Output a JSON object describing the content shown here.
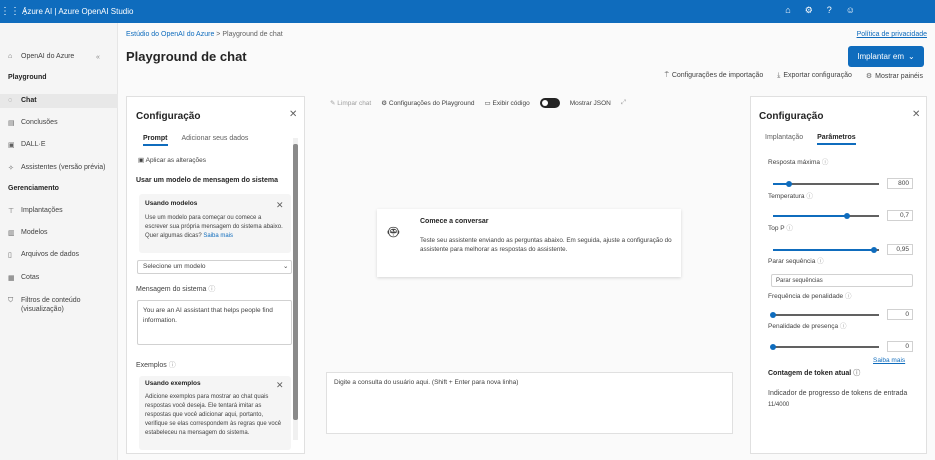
{
  "topbar": {
    "brand": "Azure AI | Azure OpenAI Studio"
  },
  "nav": {
    "openai_link": "OpenAI do Azure",
    "playground_header": "Playground",
    "chat": "Chat",
    "completions": "Conclusões",
    "dalle": "DALL·E",
    "assistants": "Assistentes (versão prévia)",
    "management_header": "Gerenciamento",
    "deployments": "Implantações",
    "models": "Modelos",
    "data_files": "Arquivos de dados",
    "quotas": "Cotas",
    "content_filters": "Filtros de conteúdo (visualização)"
  },
  "header": {
    "breadcrumb_link": "Estúdio do OpenAI do Azure",
    "breadcrumb_sep": ">",
    "breadcrumb_current": "Playground de chat",
    "privacy": "Política de privacidade",
    "title": "Playground de chat",
    "deploy": "Implantar em",
    "import_settings": "Configurações de importação",
    "export_settings": "Exportar configuração",
    "show_panels": "Mostrar painéis"
  },
  "left_panel": {
    "title": "Configuração",
    "tab_prompt": "Prompt",
    "tab_data": "Adicionar seus dados",
    "apply_changes": "Aplicar as alterações",
    "use_template": "Usar um modelo de mensagem do sistema",
    "templates_card_title": "Usando modelos",
    "templates_card_text": "Use um modelo para começar ou comece a escrever sua própria mensagem do sistema abaixo. Quer algumas dicas?",
    "templates_card_link": "Saiba mais",
    "template_select_placeholder": "Selecione um modelo",
    "system_message_label": "Mensagem do sistema",
    "system_message_value": "You are an AI assistant that helps people find information.",
    "examples_label": "Exemplos",
    "examples_card_title": "Usando exemplos",
    "examples_card_text": "Adicione exemplos para mostrar ao chat quais respostas você deseja. Ele tentará imitar as respostas que você adicionar aqui, portanto, verifique se elas correspondem às regras que você estabeleceu na mensagem do sistema."
  },
  "center": {
    "toolbar_clear": "Limpar chat",
    "toolbar_params": "Configurações do Playground",
    "toolbar_code": "Exibir código",
    "toolbar_json": "Mostrar JSON",
    "start_title": "Comece a conversar",
    "start_text": "Teste seu assistente enviando as perguntas abaixo. Em seguida, ajuste a configuração do assistente para melhorar as respostas do assistente.",
    "input_placeholder": "Digite a consulta do usuário aqui. (Shift + Enter para nova linha)"
  },
  "right_panel": {
    "title": "Configuração",
    "tab_deploy": "Implantação",
    "tab_params": "Parâmetros",
    "max_response_label": "Resposta máxima",
    "max_response_value": "800",
    "max_response_fraction": 0.15,
    "temperature_label": "Temperatura",
    "temperature_value": "0,7",
    "temperature_fraction": 0.7,
    "top_p_label": "Top P",
    "top_p_value": "0,95",
    "top_p_fraction": 0.95,
    "stop_label": "Parar sequência",
    "stop_placeholder": "Parar sequências",
    "freq_penalty_label": "Frequência de penalidade",
    "freq_penalty_value": "0",
    "freq_penalty_fraction": 0,
    "presence_penalty_label": "Penalidade de presença",
    "presence_penalty_value": "0",
    "presence_penalty_fraction": 0,
    "learn_more": "Saiba mais",
    "token_count_label": "Contagem de token atual",
    "token_progress_label": "Indicador de progresso de tokens de entrada",
    "token_progress_value": "11/4000"
  },
  "colors": {
    "accent": "#0f6cbd",
    "topbar": "#0f6cbd"
  }
}
